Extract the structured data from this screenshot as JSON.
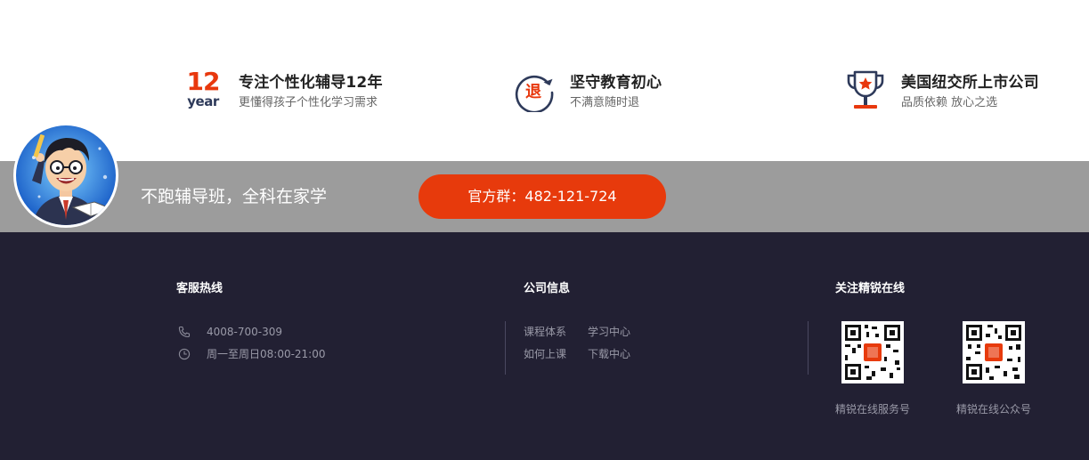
{
  "features": [
    {
      "icon": "12-year-icon",
      "icon_number": "12",
      "icon_word": "year",
      "title": "专注个性化辅导12年",
      "subtitle": "更懂得孩子个性化学习需求"
    },
    {
      "icon": "refund-icon",
      "icon_glyph": "退",
      "title": "坚守教育初心",
      "subtitle": "不满意随时退"
    },
    {
      "icon": "trophy-icon",
      "title": "美国纽交所上市公司",
      "subtitle": "品质依赖 放心之选"
    }
  ],
  "banner": {
    "slogan": "不跑辅导班，全科在家学",
    "qq_button": "官方群：482-121-724"
  },
  "footer": {
    "service": {
      "title": "客服热线",
      "phone": "4008-700-309",
      "hours": "周一至周日08:00-21:00"
    },
    "company": {
      "title": "公司信息",
      "links": [
        "课程体系",
        "学习中心",
        "如何上课",
        "下载中心"
      ]
    },
    "follow": {
      "title": "关注精锐在线",
      "qr_labels": [
        "精锐在线服务号",
        "精锐在线公众号"
      ]
    }
  },
  "colors": {
    "accent": "#e73a0c",
    "banner_gray": "#9c9c9c",
    "footer_bg": "#222033",
    "navy": "#2e3a5a"
  }
}
